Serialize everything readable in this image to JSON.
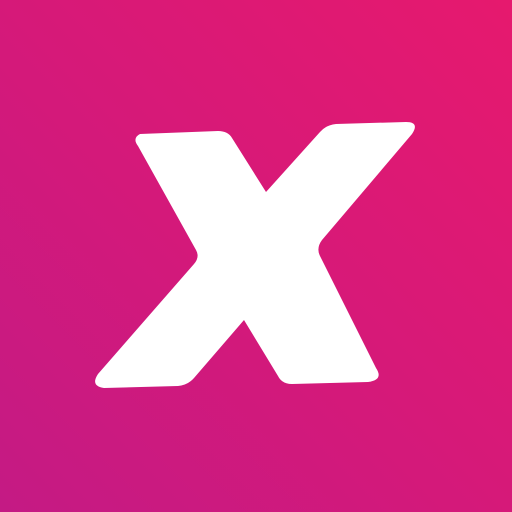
{
  "icon": {
    "name": "x-logo-icon",
    "glyph": "X",
    "background_colors": [
      "#e6196e",
      "#d4197a",
      "#c41a84"
    ],
    "glyph_color": "#ffffff"
  }
}
